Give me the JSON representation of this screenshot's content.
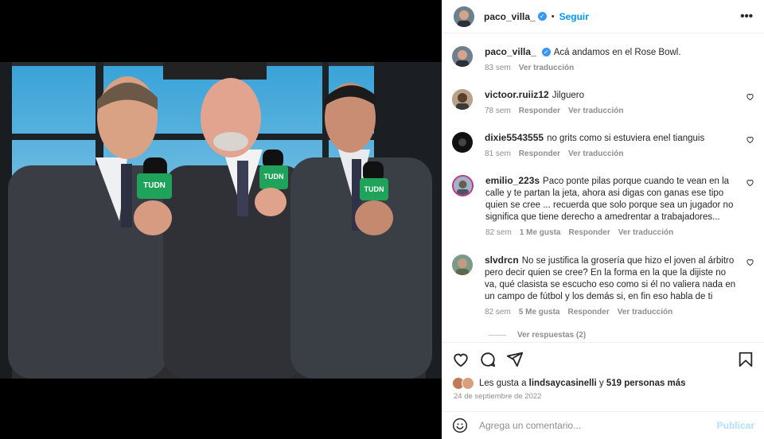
{
  "post": {
    "author": "paco_villa_",
    "follow_label": "Seguir",
    "more_label": "•••",
    "caption": "Acá andamos en el Rose Bowl.",
    "caption_time": "83 sem",
    "translate_label": "Ver traducción",
    "reply_label": "Responder",
    "comments": [
      {
        "user": "victoor.ruiiz12",
        "text": "Jilguero",
        "time": "78 sem"
      },
      {
        "user": "dixie5543555",
        "text": "no grits como si estuviera enel tianguis",
        "time": "81 sem"
      },
      {
        "user": "emilio_223s",
        "text": "Paco ponte pilas porque cuando te vean en la calle y te partan la jeta, ahora asi digas con ganas ese tipo quien se cree ... recuerda que solo porque sea un jugador no significa que tiene derecho a amedrentar a trabajadores...",
        "time": "82 sem",
        "likes": "1 Me gusta"
      },
      {
        "user": "slvdrcn",
        "text": "No se justifica la grosería que hizo el joven al árbitro pero decir quien se cree? En la forma en la que la dijiste no va, qué clasista se escucho eso como si él no valiera nada en un campo de fútbol y los demás si, en fin eso habla de ti",
        "time": "82 sem",
        "likes": "5 Me gusta"
      }
    ],
    "view_replies": "Ver respuestas (2)",
    "likes_prefix": "Les gusta a",
    "likes_user": "lindsaycasinelli",
    "likes_conj": "y",
    "likes_count": "519 personas más",
    "date": "24 de septiembre de 2022",
    "comment_placeholder": "Agrega un comentario...",
    "publish_label": "Publicar"
  },
  "photo": {
    "mic_label": "TUDN"
  },
  "colors": {
    "accent": "#0095f6",
    "verified": "#3897f0",
    "mic_green": "#1fa35a"
  },
  "icons": [
    "verified-icon",
    "heart-icon",
    "comment-icon",
    "share-icon",
    "save-icon",
    "emoji-icon",
    "more-icon"
  ]
}
